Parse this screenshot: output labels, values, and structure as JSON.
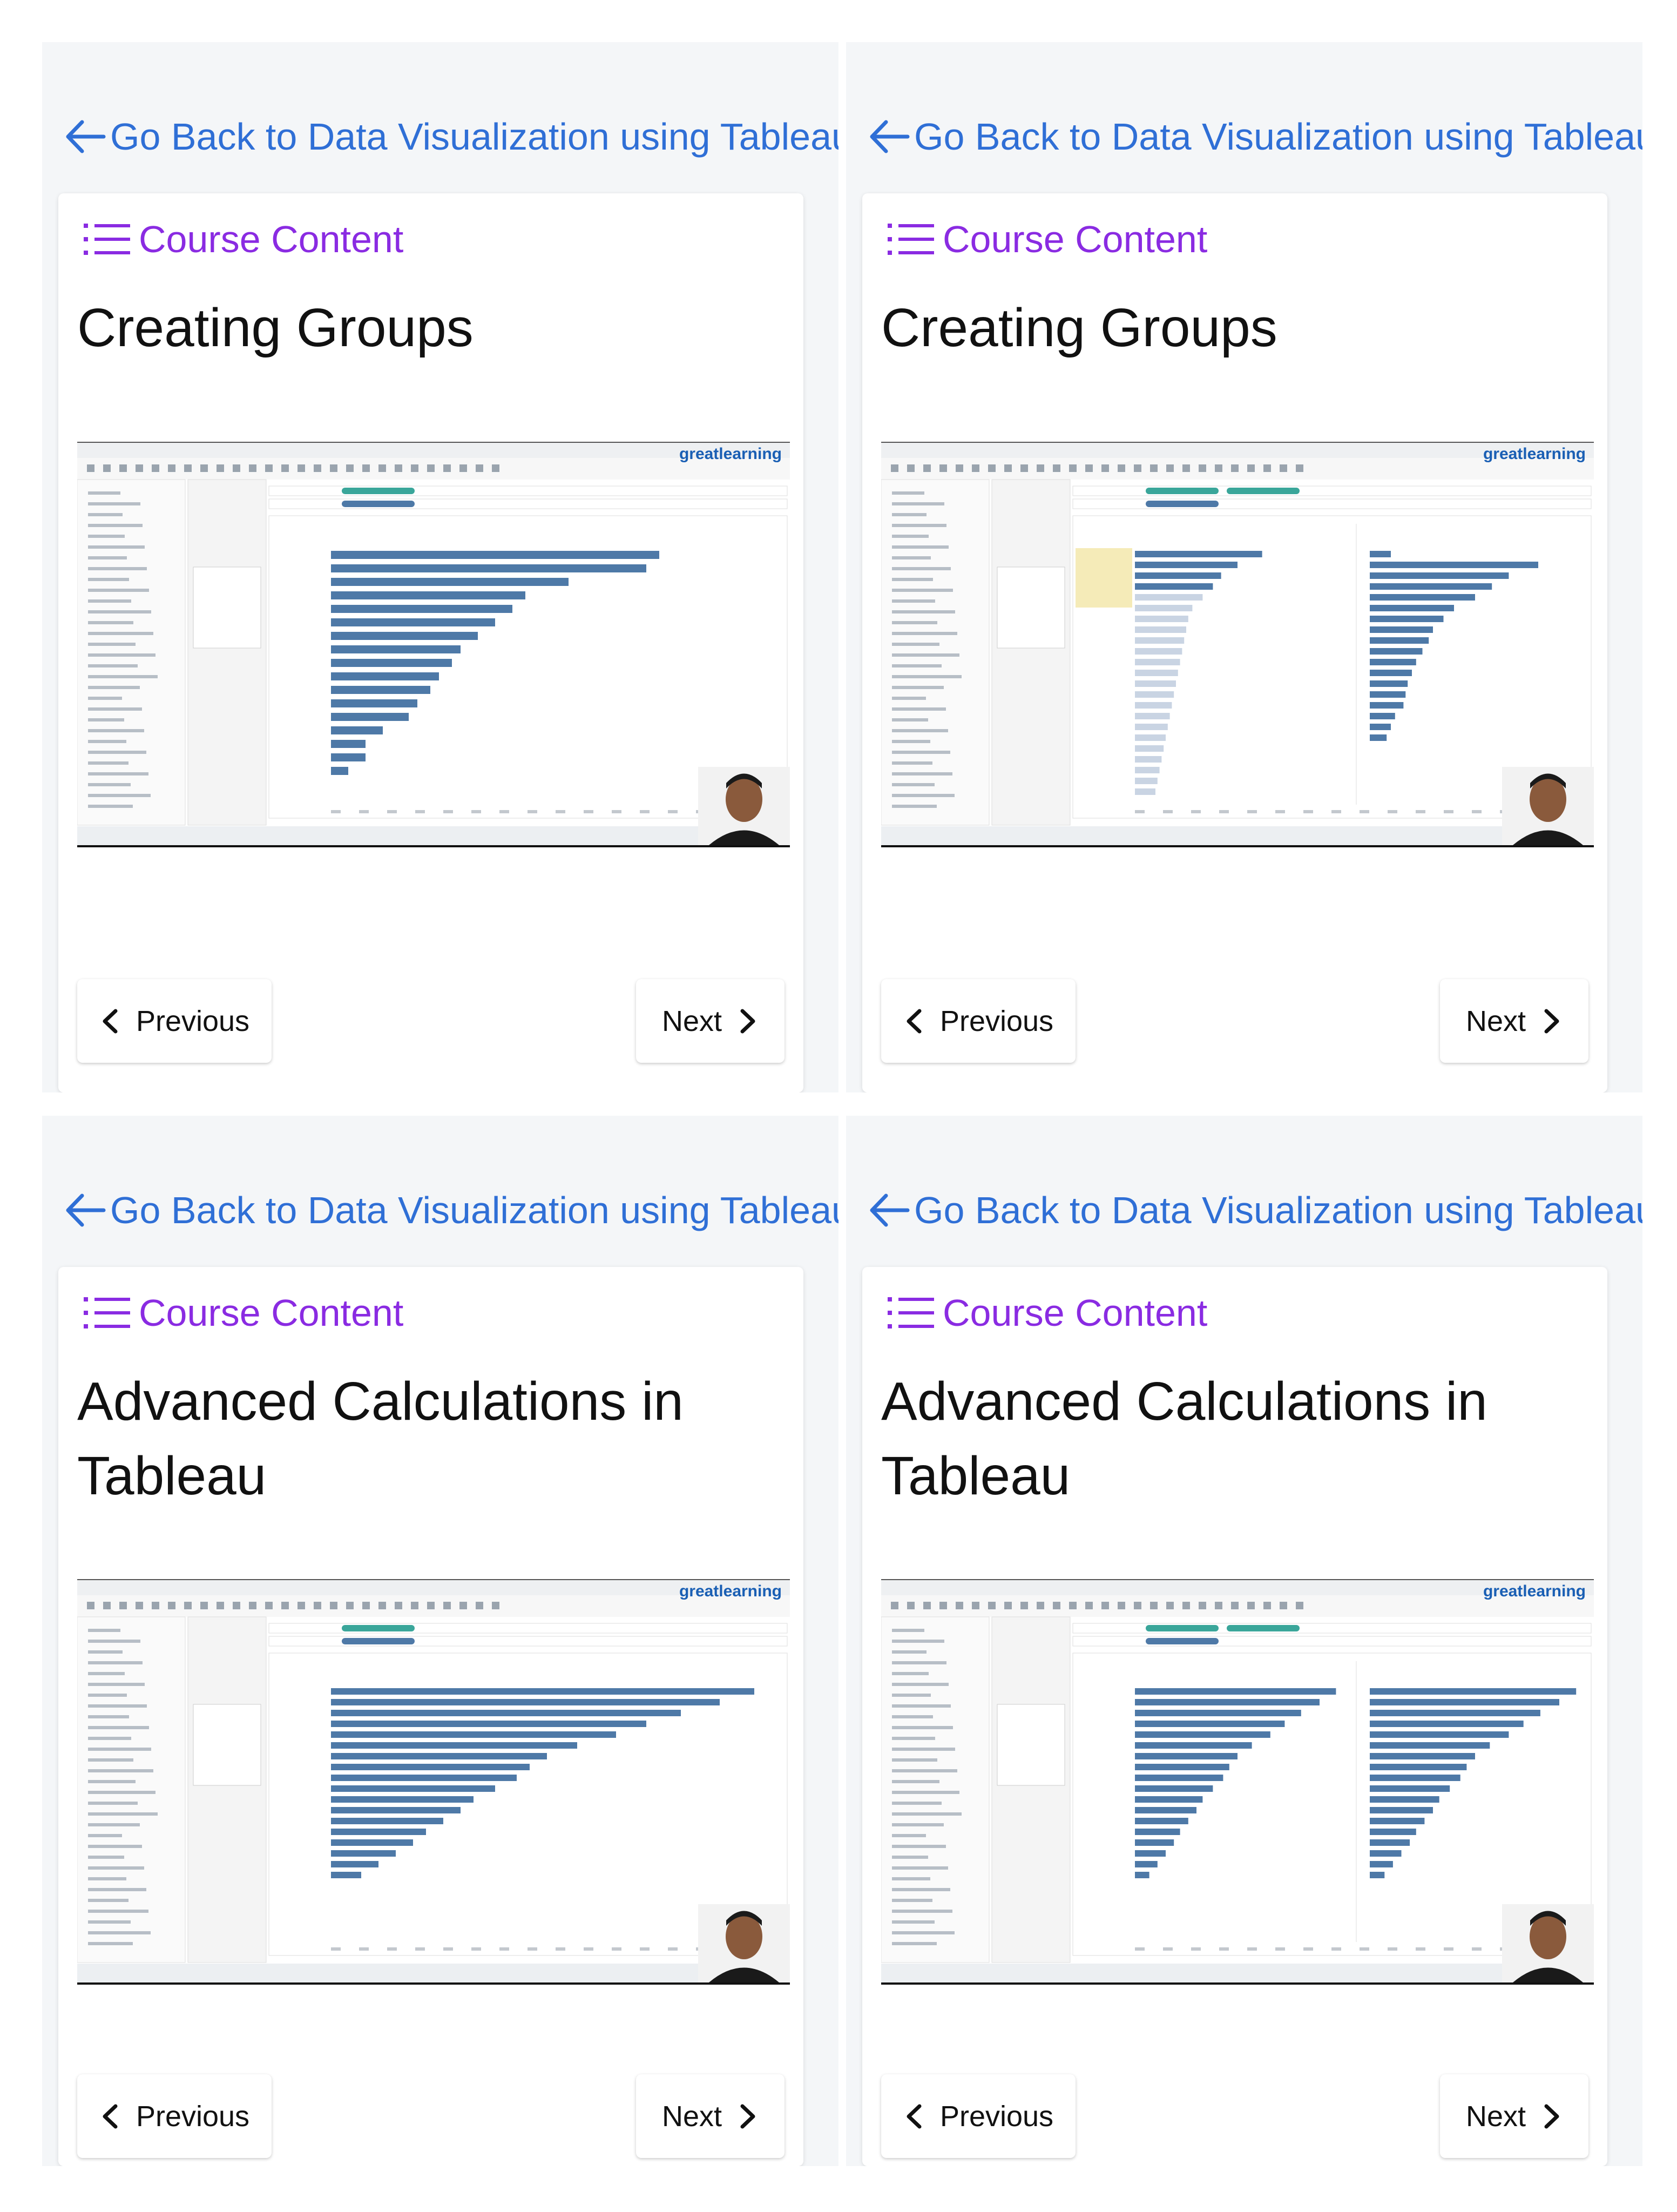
{
  "panels": [
    {
      "back_label": "Go Back to Data Visualization using Tableau",
      "course_content_label": "Course Content",
      "lesson_title": "Creating Groups",
      "prev_label": "Previous",
      "next_label": "Next",
      "video_brand": "greatlearning"
    },
    {
      "back_label": "Go Back to Data Visualization using Tableau",
      "course_content_label": "Course Content",
      "lesson_title": "Creating Groups",
      "prev_label": "Previous",
      "next_label": "Next",
      "video_brand": "greatlearning"
    },
    {
      "back_label": "Go Back to Data Visualization using Tableau",
      "course_content_label": "Course Content",
      "lesson_title": "Advanced Calculations in Tableau",
      "prev_label": "Previous",
      "next_label": "Next",
      "video_brand": "greatlearning"
    },
    {
      "back_label": "Go Back to Data Visualization using Tableau",
      "course_content_label": "Course Content",
      "lesson_title": "Advanced Calculations in Tableau",
      "prev_label": "Previous",
      "next_label": "Next",
      "video_brand": "greatlearning"
    }
  ],
  "colors": {
    "link_blue": "#2f6fd6",
    "course_purple": "#8a2be2",
    "tableau_bar": "#4e79a7",
    "tableau_pill": "#3aa69a"
  },
  "icons": [
    "arrow-left-icon",
    "list-icon",
    "chevron-left-icon",
    "chevron-right-icon"
  ]
}
